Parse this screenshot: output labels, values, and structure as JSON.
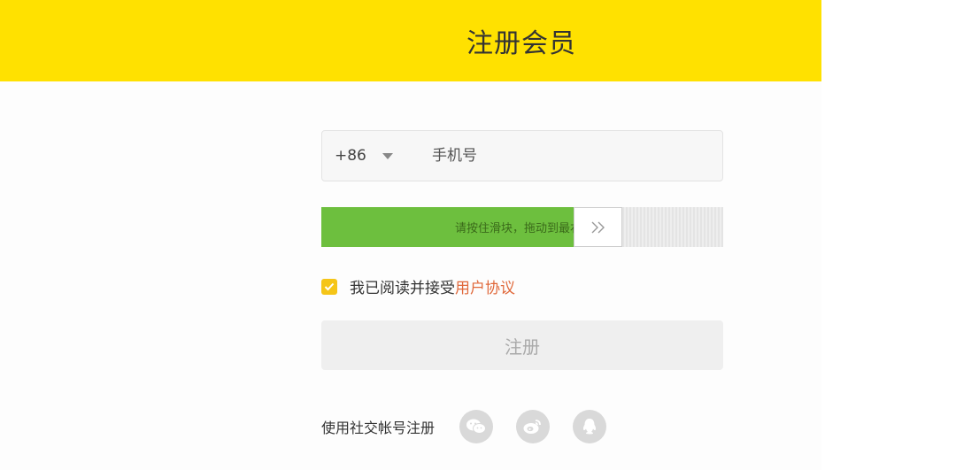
{
  "header": {
    "title": "注册会员"
  },
  "phone": {
    "country_code": "+86",
    "placeholder": "手机号"
  },
  "slider": {
    "hint": "请按住滑块，拖动到最右边",
    "progress": 0.628
  },
  "agreement": {
    "checked": true,
    "text": "我已阅读并接受",
    "link_text": "用户协议"
  },
  "submit": {
    "label": "注册"
  },
  "social": {
    "label": "使用社交帐号注册",
    "icons": [
      "wechat-icon",
      "weibo-icon",
      "qq-icon"
    ]
  },
  "colors": {
    "header_bg": "#ffe100",
    "slider_fill": "#6dbf3e",
    "link": "#e0683a",
    "checkbox": "#f5c518"
  }
}
